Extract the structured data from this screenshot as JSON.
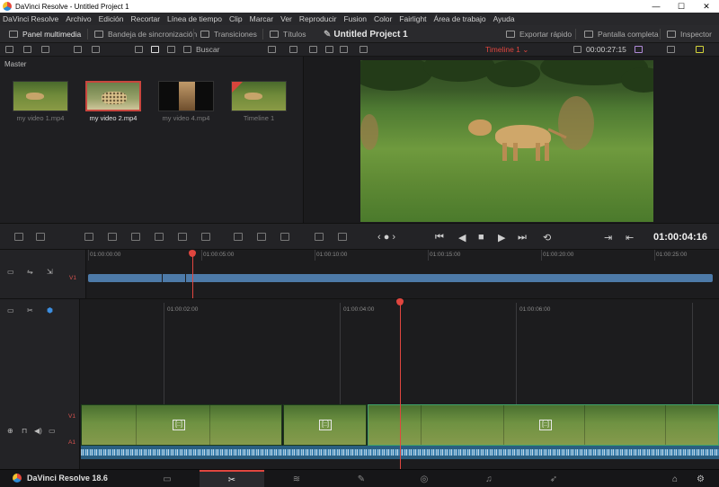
{
  "window": {
    "title": "DaVinci Resolve - Untitled Project 1",
    "min": "—",
    "max": "☐",
    "close": "✕"
  },
  "menu": [
    "DaVinci Resolve",
    "Archivo",
    "Edición",
    "Recortar",
    "Línea de tiempo",
    "Clip",
    "Marcar",
    "Ver",
    "Reproducir",
    "Fusion",
    "Color",
    "Fairlight",
    "Área de trabajo",
    "Ayuda"
  ],
  "toolbar": {
    "media_pool": "Panel multimedia",
    "sync_bin": "Bandeja de sincronización",
    "transitions": "Transiciones",
    "titles": "Títulos",
    "project_title": "Untitled Project 1",
    "quick_export": "Exportar rápido",
    "fullscreen": "Pantalla completa",
    "inspector": "Inspector"
  },
  "subtoolbar": {
    "search": "Buscar",
    "timeline": "Timeline 1 ⌄",
    "timecode": "00:00:27:15"
  },
  "media_pool": {
    "bin": "Master",
    "clips": [
      {
        "name": "my video 1.mp4",
        "selected": false
      },
      {
        "name": "my video 2.mp4",
        "selected": true
      },
      {
        "name": "my video 4.mp4",
        "selected": false
      },
      {
        "name": "Timeline 1",
        "selected": false
      }
    ]
  },
  "transport": {
    "timecode": "01:00:04:16"
  },
  "overview_ruler": [
    "01:00:00:00",
    "01:00:05:00",
    "01:00:10:00",
    "01:00:15:00",
    "01:00:20:00",
    "01:00:25:00"
  ],
  "detail_ruler": [
    "01:00:02:00",
    "01:00:04:00",
    "01:00:06:00"
  ],
  "tracks": {
    "overview_video": "V1",
    "video": "V1",
    "audio": "A1"
  },
  "fx_label": "[::]",
  "brand": "DaVinci Resolve 18.6",
  "pages": [
    "▭",
    "✂",
    "≋",
    "✎",
    "◎",
    "♫",
    "➶"
  ],
  "colors": {
    "accent": "#e0463f",
    "clip_blue": "#4d7aa8",
    "audio": "#2a5e80"
  }
}
